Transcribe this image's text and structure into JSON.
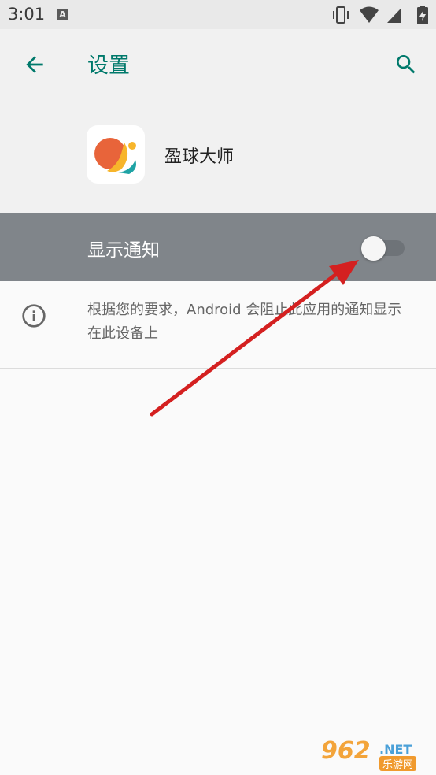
{
  "status_bar": {
    "time": "3:01",
    "notification_icon_letter": "A",
    "icons": [
      "vibrate-icon",
      "wifi-icon",
      "signal-icon",
      "battery-charging-icon"
    ]
  },
  "app_bar": {
    "title": "设置",
    "back_icon": "arrow-back-icon",
    "search_icon": "search-icon",
    "accent_color": "#00796b"
  },
  "app_header": {
    "app_name": "盈球大师"
  },
  "notification_setting": {
    "label": "显示通知",
    "enabled": false
  },
  "info": {
    "icon": "info-icon",
    "text": "根据您的要求，Android 会阻止此应用的通知显示在此设备上"
  },
  "watermark": {
    "main": "962",
    "net": ".NET",
    "sub": "乐游网"
  }
}
